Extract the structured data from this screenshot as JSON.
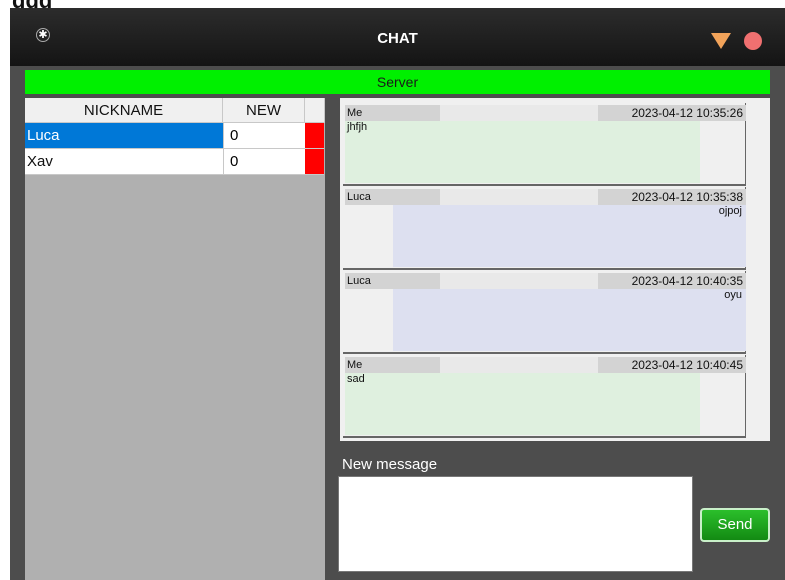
{
  "header_fragment": "ggg",
  "window": {
    "title": "CHAT",
    "minimize_icon": "triangle-down-icon",
    "close_icon": "circle-close-icon",
    "app_icon": "asterisk-icon"
  },
  "server": {
    "label": "Server",
    "color": "#00f000"
  },
  "users_table": {
    "columns": [
      "NICKNAME",
      "NEW"
    ],
    "rows": [
      {
        "nickname": "Luca",
        "new": "0",
        "selected": true
      },
      {
        "nickname": "Xav",
        "new": "0",
        "selected": false
      }
    ],
    "selected_color": "#0078d7",
    "flag_color": "#ff0000"
  },
  "messages": [
    {
      "user": "Me",
      "time": "2023-04-12 10:35:26",
      "text": "jhfjh",
      "mine": true
    },
    {
      "user": "Luca",
      "time": "2023-04-12 10:35:38",
      "text": "ojpoj",
      "mine": false
    },
    {
      "user": "Luca",
      "time": "2023-04-12 10:40:35",
      "text": "oyu",
      "mine": false
    },
    {
      "user": "Me",
      "time": "2023-04-12 10:40:45",
      "text": "sad",
      "mine": true
    }
  ],
  "compose": {
    "label": "New message",
    "value": "",
    "send_label": "Send"
  }
}
